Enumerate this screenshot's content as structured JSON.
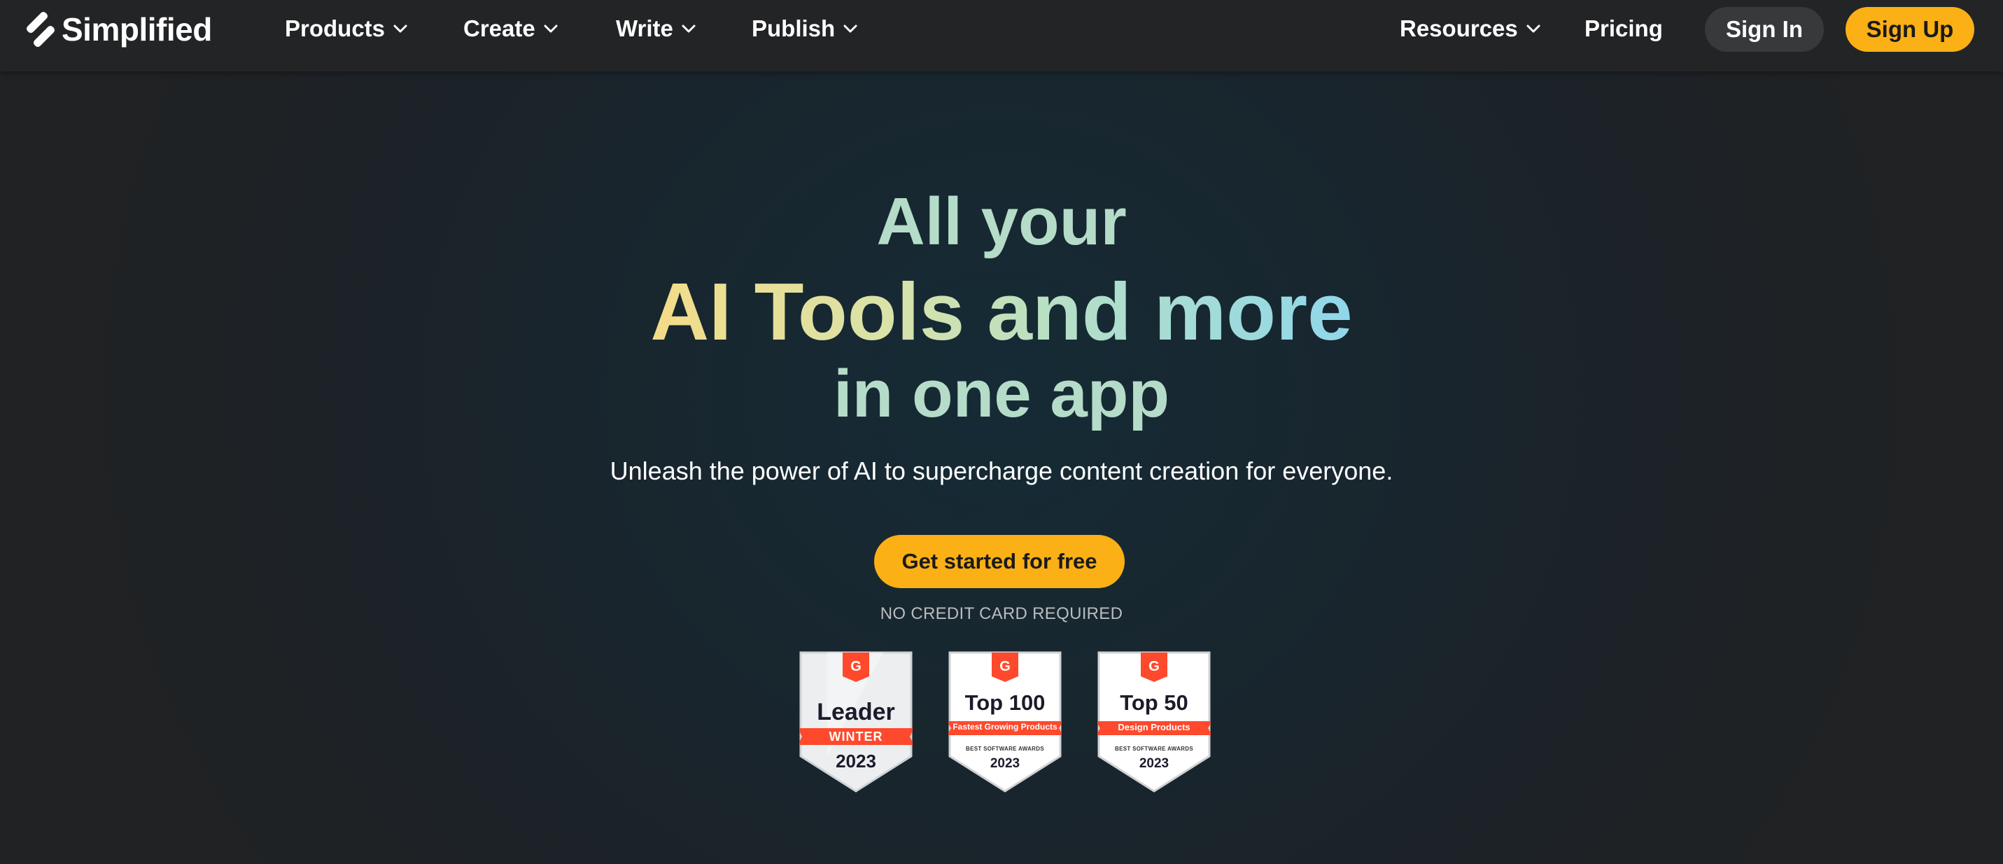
{
  "nav": {
    "logo_text": "Simplified",
    "items": [
      {
        "label": "Products"
      },
      {
        "label": "Create"
      },
      {
        "label": "Write"
      },
      {
        "label": "Publish"
      }
    ],
    "resources_label": "Resources",
    "pricing_label": "Pricing",
    "signin_label": "Sign In",
    "signup_label": "Sign Up"
  },
  "hero": {
    "line1": "All your",
    "line2": "AI Tools and more",
    "line3": "in one app",
    "subtitle": "Unleash the power of AI to supercharge content creation for everyone.",
    "cta_label": "Get started for free",
    "note": "NO CREDIT CARD REQUIRED"
  },
  "badges": [
    {
      "title": "Leader",
      "ribbon": "WINTER",
      "award": "",
      "year": "2023"
    },
    {
      "title": "Top 100",
      "ribbon": "Fastest Growing Products",
      "award": "BEST SOFTWARE AWARDS",
      "year": "2023"
    },
    {
      "title": "Top 50",
      "ribbon": "Design Products",
      "award": "BEST SOFTWARE AWARDS",
      "year": "2023"
    }
  ],
  "colors": {
    "accent": "#fbb015",
    "nav_bg": "#232425",
    "g2_red": "#ff492c"
  }
}
